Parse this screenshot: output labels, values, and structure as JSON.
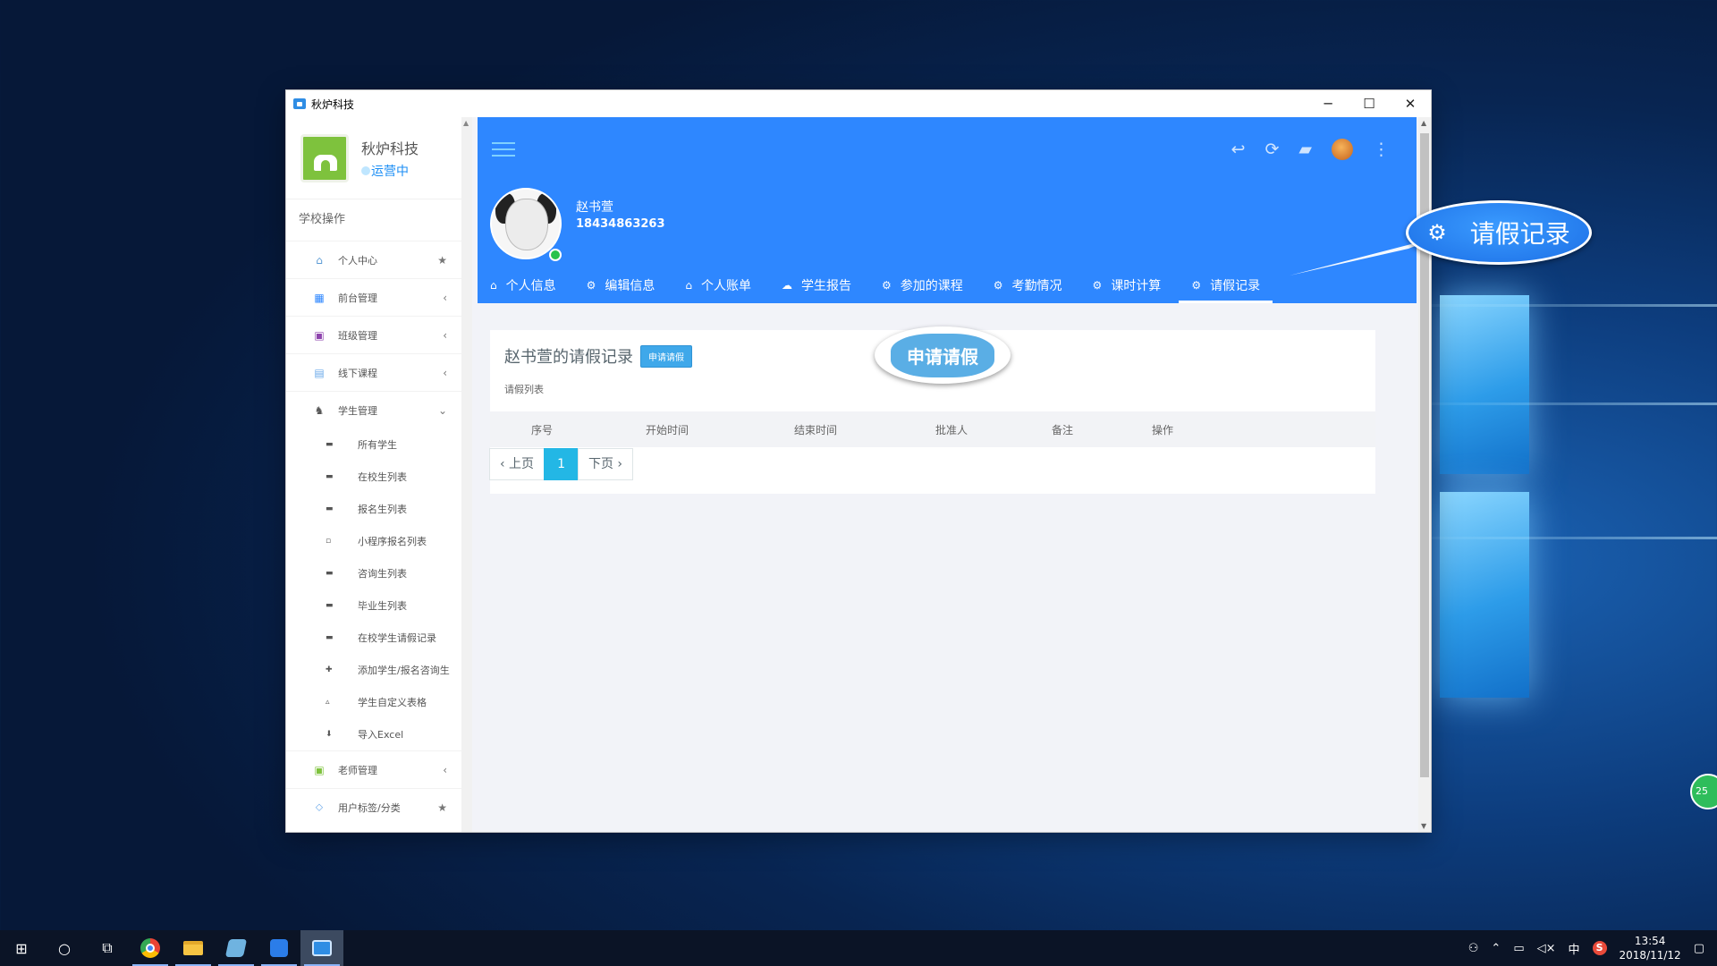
{
  "window": {
    "title": "秋炉科技",
    "controls": {
      "minimize": "─",
      "maximize": "☐",
      "close": "✕"
    }
  },
  "sidebar": {
    "org_name": "秋炉科技",
    "org_status": "运营中",
    "section_title": "学校操作",
    "items": [
      {
        "label": "个人中心",
        "icon": "home-icon",
        "glyph": "⌂",
        "color": "#5b9bd5",
        "tail": "★"
      },
      {
        "label": "前台管理",
        "icon": "dashboard-icon",
        "glyph": "▦",
        "color": "#2e87ff",
        "tail": "‹"
      },
      {
        "label": "班级管理",
        "icon": "class-icon",
        "glyph": "▣",
        "color": "#8e44ad",
        "tail": "‹"
      },
      {
        "label": "线下课程",
        "icon": "book-icon",
        "glyph": "▤",
        "color": "#6aa9e9",
        "tail": "‹"
      },
      {
        "label": "学生管理",
        "icon": "student-icon",
        "glyph": "♞",
        "color": "#555555",
        "tail": "⌄"
      }
    ],
    "sub_items": [
      {
        "label": "所有学生",
        "glyph": "▬"
      },
      {
        "label": "在校生列表",
        "glyph": "▬"
      },
      {
        "label": "报名生列表",
        "glyph": "▬"
      },
      {
        "label": "小程序报名列表",
        "glyph": "▫"
      },
      {
        "label": "咨询生列表",
        "glyph": "▬"
      },
      {
        "label": "毕业生列表",
        "glyph": "▬"
      },
      {
        "label": "在校学生请假记录",
        "glyph": "▬"
      },
      {
        "label": "添加学生/报名咨询生",
        "glyph": "✚"
      },
      {
        "label": "学生自定义表格",
        "glyph": "▵"
      },
      {
        "label": "导入Excel",
        "glyph": "⬇"
      }
    ],
    "items_after": [
      {
        "label": "老师管理",
        "icon": "teacher-icon",
        "glyph": "▣",
        "color": "#7ec23d",
        "tail": "‹"
      },
      {
        "label": "用户标签/分类",
        "icon": "tag-icon",
        "glyph": "⬦",
        "color": "#6aa9e9",
        "tail": "★"
      }
    ]
  },
  "header": {
    "user_name": "赵书萱",
    "user_phone": "18434863263",
    "tools": [
      {
        "icon": "back-icon",
        "glyph": "↩"
      },
      {
        "icon": "refresh-icon",
        "glyph": "⟳"
      },
      {
        "icon": "message-icon",
        "glyph": "▰"
      }
    ]
  },
  "tabs": [
    {
      "label": "个人信息",
      "glyph": "⌂",
      "icon": "home-icon"
    },
    {
      "label": "编辑信息",
      "glyph": "⚙",
      "icon": "gear-icon"
    },
    {
      "label": "个人账单",
      "glyph": "⌂",
      "icon": "home-icon"
    },
    {
      "label": "学生报告",
      "glyph": "☁",
      "icon": "report-icon"
    },
    {
      "label": "参加的课程",
      "glyph": "⚙",
      "icon": "gear-icon"
    },
    {
      "label": "考勤情况",
      "glyph": "⚙",
      "icon": "gear-icon"
    },
    {
      "label": "课时计算",
      "glyph": "⚙",
      "icon": "gear-icon"
    },
    {
      "label": "请假记录",
      "glyph": "⚙",
      "icon": "gear-icon",
      "active": true
    }
  ],
  "card": {
    "title": "赵书萱的请假记录",
    "apply_button": "申请请假",
    "subtitle": "请假列表",
    "columns": [
      "序号",
      "开始时间",
      "结束时间",
      "批准人",
      "备注",
      "操作"
    ],
    "pager": {
      "prev": "‹ 上页",
      "current": "1",
      "next": "下页 ›"
    }
  },
  "callouts": {
    "big_label": "请假记录",
    "small_label": "申请请假"
  },
  "desktop_badge": "25",
  "taskbar": {
    "ime": "中",
    "time": "13:54",
    "date": "2018/11/12"
  },
  "colors": {
    "accent": "#2e87ff",
    "pager_active": "#23b7e5",
    "status": "#1b8ef5"
  }
}
